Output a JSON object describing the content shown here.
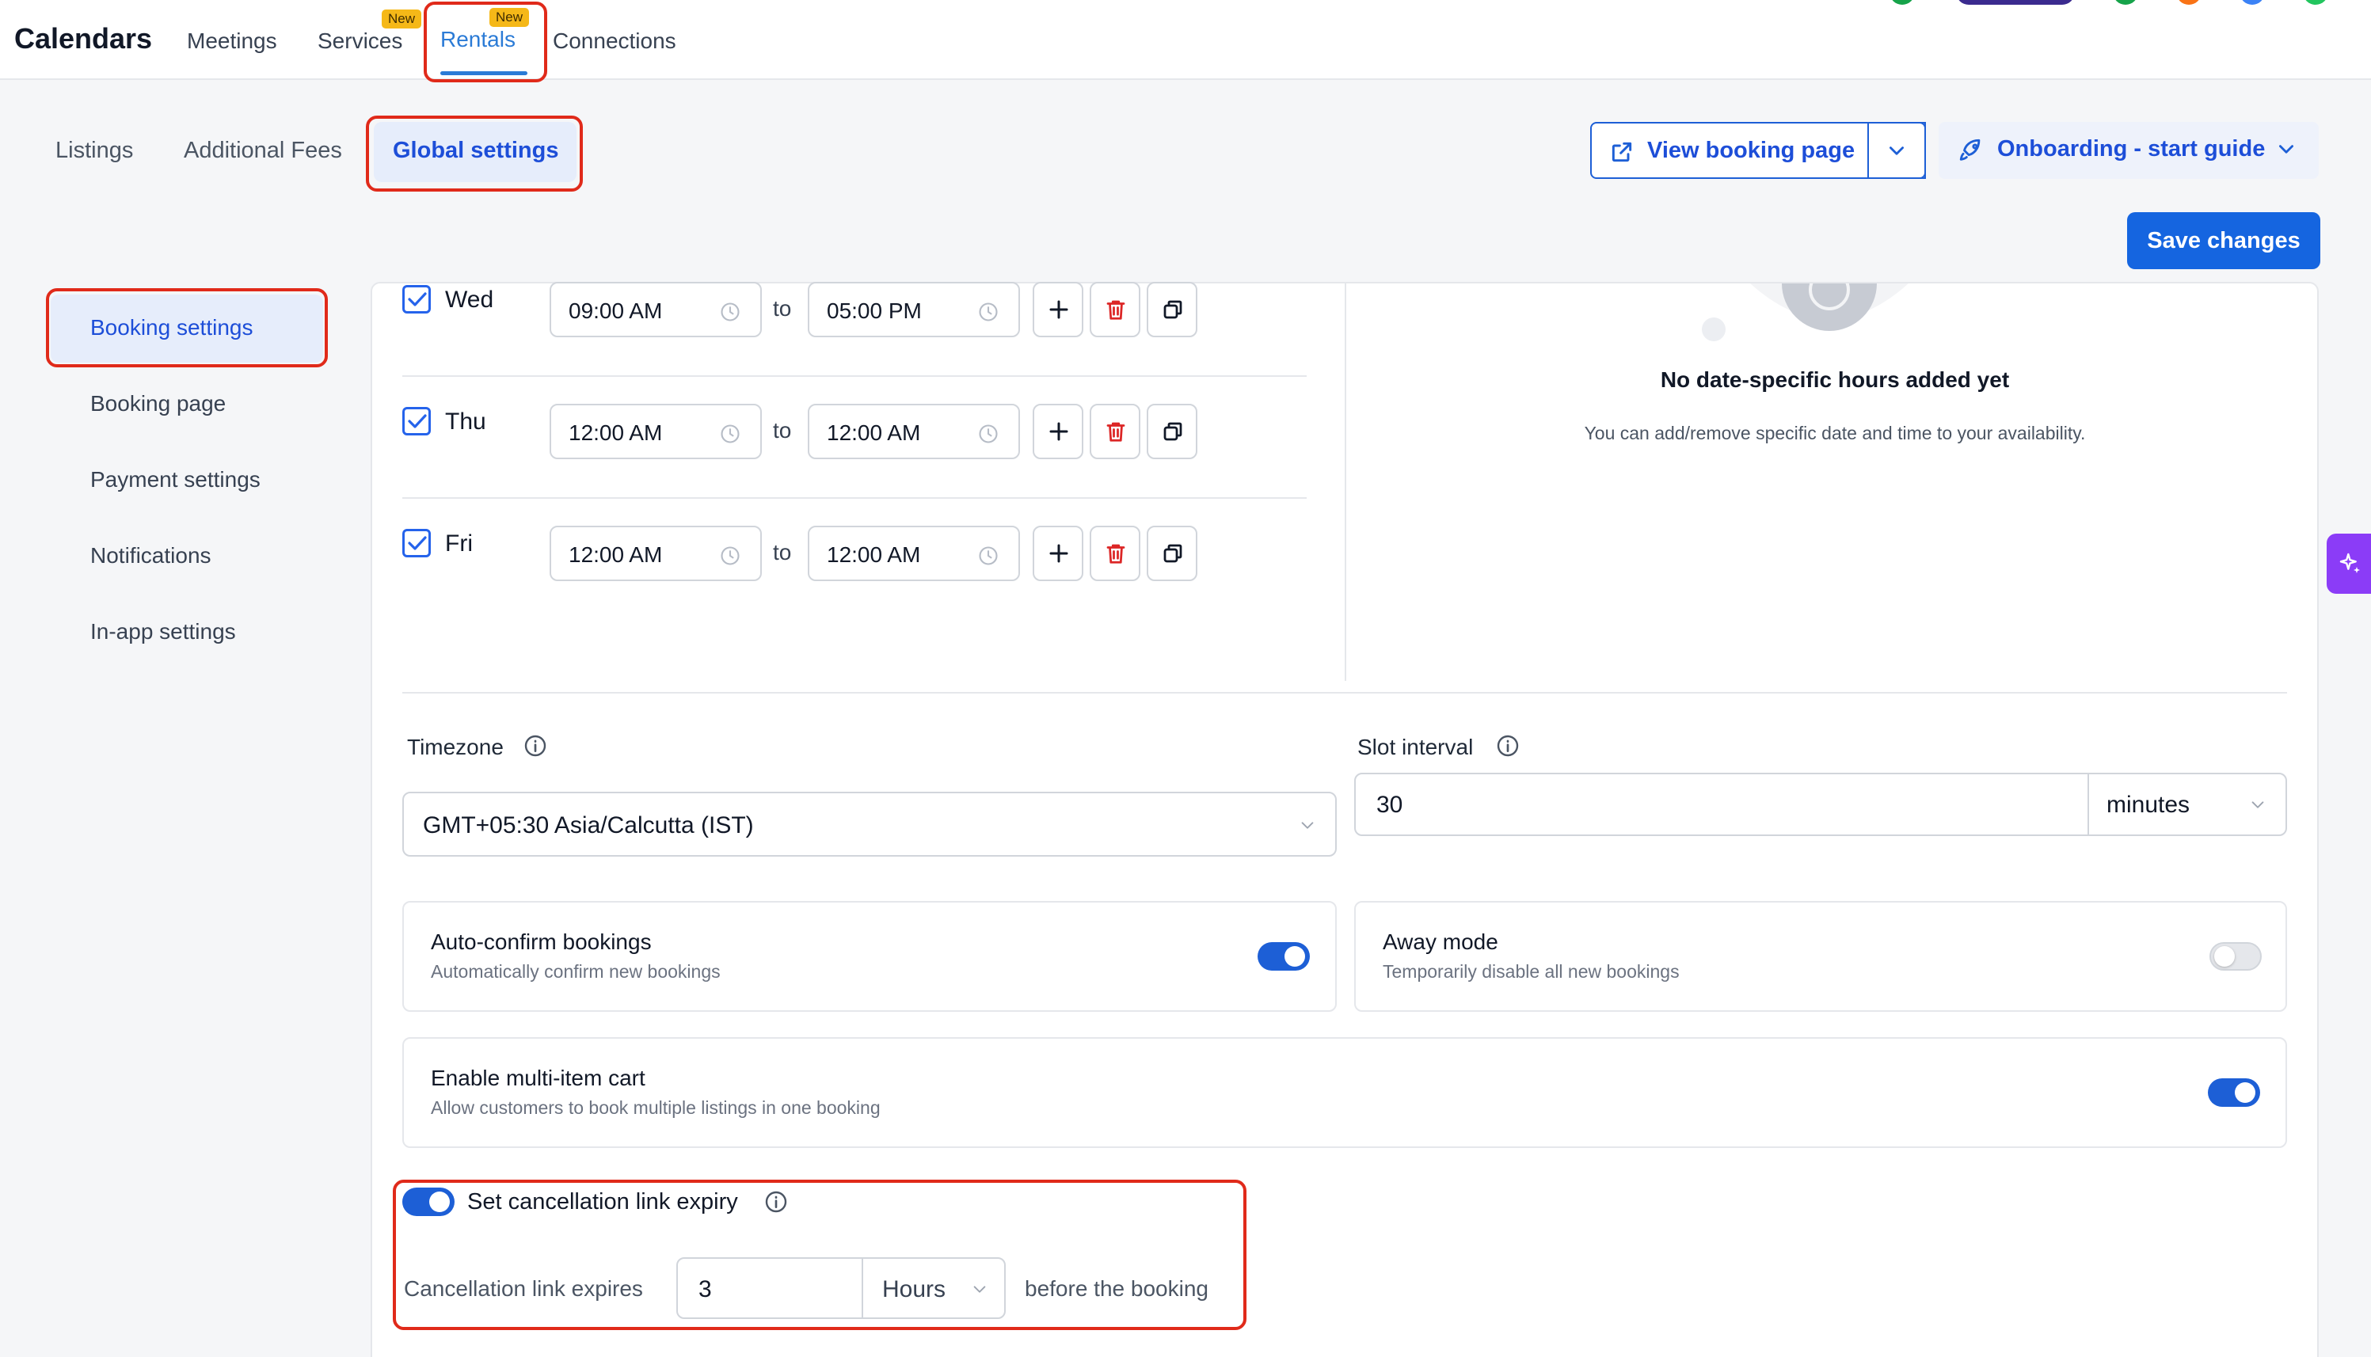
{
  "topbar": {
    "brand": "Calendars",
    "nav": [
      {
        "label": "Meetings"
      },
      {
        "label": "Services",
        "badge": "New"
      },
      {
        "label": "Rentals",
        "badge": "New",
        "active": true
      },
      {
        "label": "Connections"
      }
    ]
  },
  "subtabs": [
    {
      "label": "Listings"
    },
    {
      "label": "Additional Fees"
    },
    {
      "label": "Global settings",
      "active": true
    }
  ],
  "actions": {
    "view_booking": "View booking page",
    "onboarding": "Onboarding - start guide",
    "save": "Save changes"
  },
  "sidebar": {
    "items": [
      {
        "label": "Booking settings",
        "active": true
      },
      {
        "label": "Booking page"
      },
      {
        "label": "Payment settings"
      },
      {
        "label": "Notifications"
      },
      {
        "label": "In-app settings"
      }
    ]
  },
  "schedule": {
    "to_label": "to",
    "days": [
      {
        "day": "Wed",
        "checked": true,
        "from": "09:00 AM",
        "to": "05:00 PM"
      },
      {
        "day": "Thu",
        "checked": true,
        "from": "12:00 AM",
        "to": "12:00 AM"
      },
      {
        "day": "Fri",
        "checked": true,
        "from": "12:00 AM",
        "to": "12:00 AM"
      }
    ]
  },
  "date_specific": {
    "title": "No date-specific hours added yet",
    "desc": "You can add/remove specific date and time to your availability."
  },
  "timezone": {
    "label": "Timezone",
    "value": "GMT+05:30 Asia/Calcutta (IST)"
  },
  "slot_interval": {
    "label": "Slot interval",
    "value": "30",
    "unit": "minutes"
  },
  "toggles": {
    "auto_confirm": {
      "title": "Auto-confirm bookings",
      "desc": "Automatically confirm new bookings",
      "on": true
    },
    "away_mode": {
      "title": "Away mode",
      "desc": "Temporarily disable all new bookings",
      "on": false
    },
    "multi_cart": {
      "title": "Enable multi-item cart",
      "desc": "Allow customers to book multiple listings in one booking",
      "on": true
    }
  },
  "cancellation": {
    "toggle_label": "Set cancellation link expiry",
    "enabled": true,
    "prefix": "Cancellation link expires",
    "value": "3",
    "unit": "Hours",
    "suffix": "before the booking"
  },
  "colors": {
    "accent": "#1d5fd6",
    "highlight": "#e02a1a",
    "badge": "#f5b818",
    "ai_button": "#8b3cf7"
  }
}
